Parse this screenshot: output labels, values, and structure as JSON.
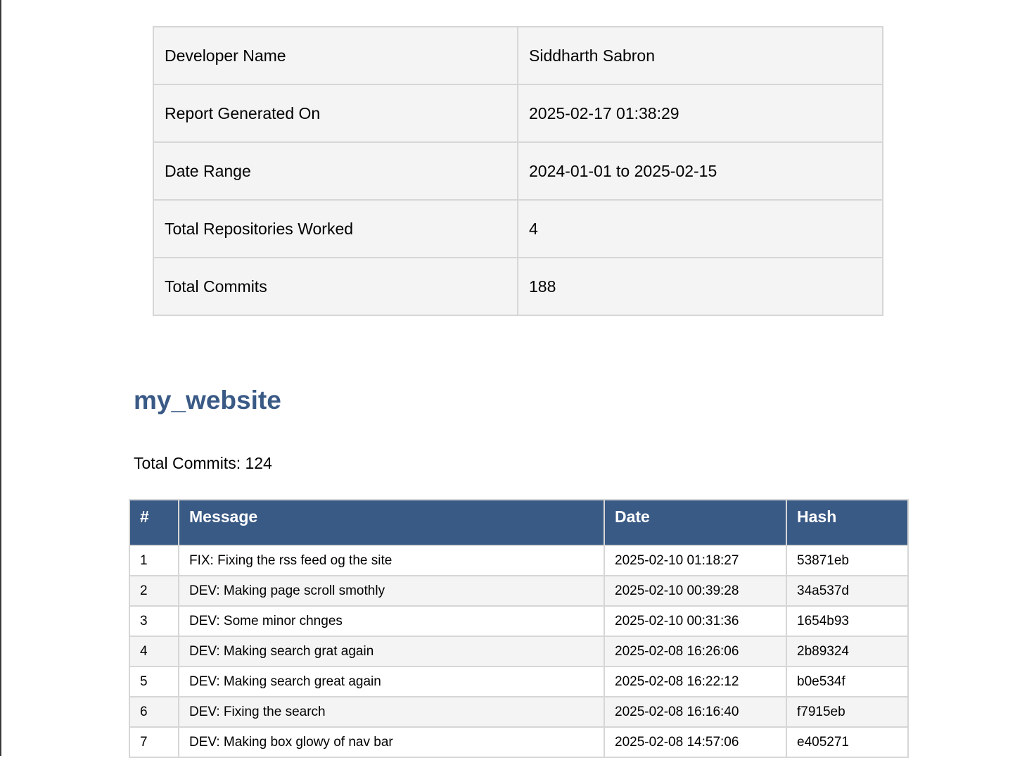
{
  "summary": [
    {
      "label": "Developer Name",
      "value": "Siddharth Sabron"
    },
    {
      "label": "Report Generated On",
      "value": "2025-02-17 01:38:29"
    },
    {
      "label": "Date Range",
      "value": "2024-01-01 to 2025-02-15"
    },
    {
      "label": "Total Repositories Worked",
      "value": "4"
    },
    {
      "label": "Total Commits",
      "value": "188"
    }
  ],
  "repository": {
    "name": "my_website",
    "total_commits_text": "Total Commits: 124",
    "columns": [
      "#",
      "Message",
      "Date",
      "Hash"
    ],
    "commits": [
      {
        "num": "1",
        "message": "FIX: Fixing the rss feed og the site",
        "date": "2025-02-10 01:18:27",
        "hash": "53871eb"
      },
      {
        "num": "2",
        "message": "DEV: Making page scroll smothly",
        "date": "2025-02-10 00:39:28",
        "hash": "34a537d"
      },
      {
        "num": "3",
        "message": "DEV: Some minor chnges",
        "date": "2025-02-10 00:31:36",
        "hash": "1654b93"
      },
      {
        "num": "4",
        "message": "DEV: Making search grat again",
        "date": "2025-02-08 16:26:06",
        "hash": "2b89324"
      },
      {
        "num": "5",
        "message": "DEV: Making search great again",
        "date": "2025-02-08 16:22:12",
        "hash": "b0e534f"
      },
      {
        "num": "6",
        "message": "DEV: Fixing the search",
        "date": "2025-02-08 16:16:40",
        "hash": "f7915eb"
      },
      {
        "num": "7",
        "message": "DEV: Making box glowy of nav bar",
        "date": "2025-02-08 14:57:06",
        "hash": "e405271"
      }
    ]
  }
}
